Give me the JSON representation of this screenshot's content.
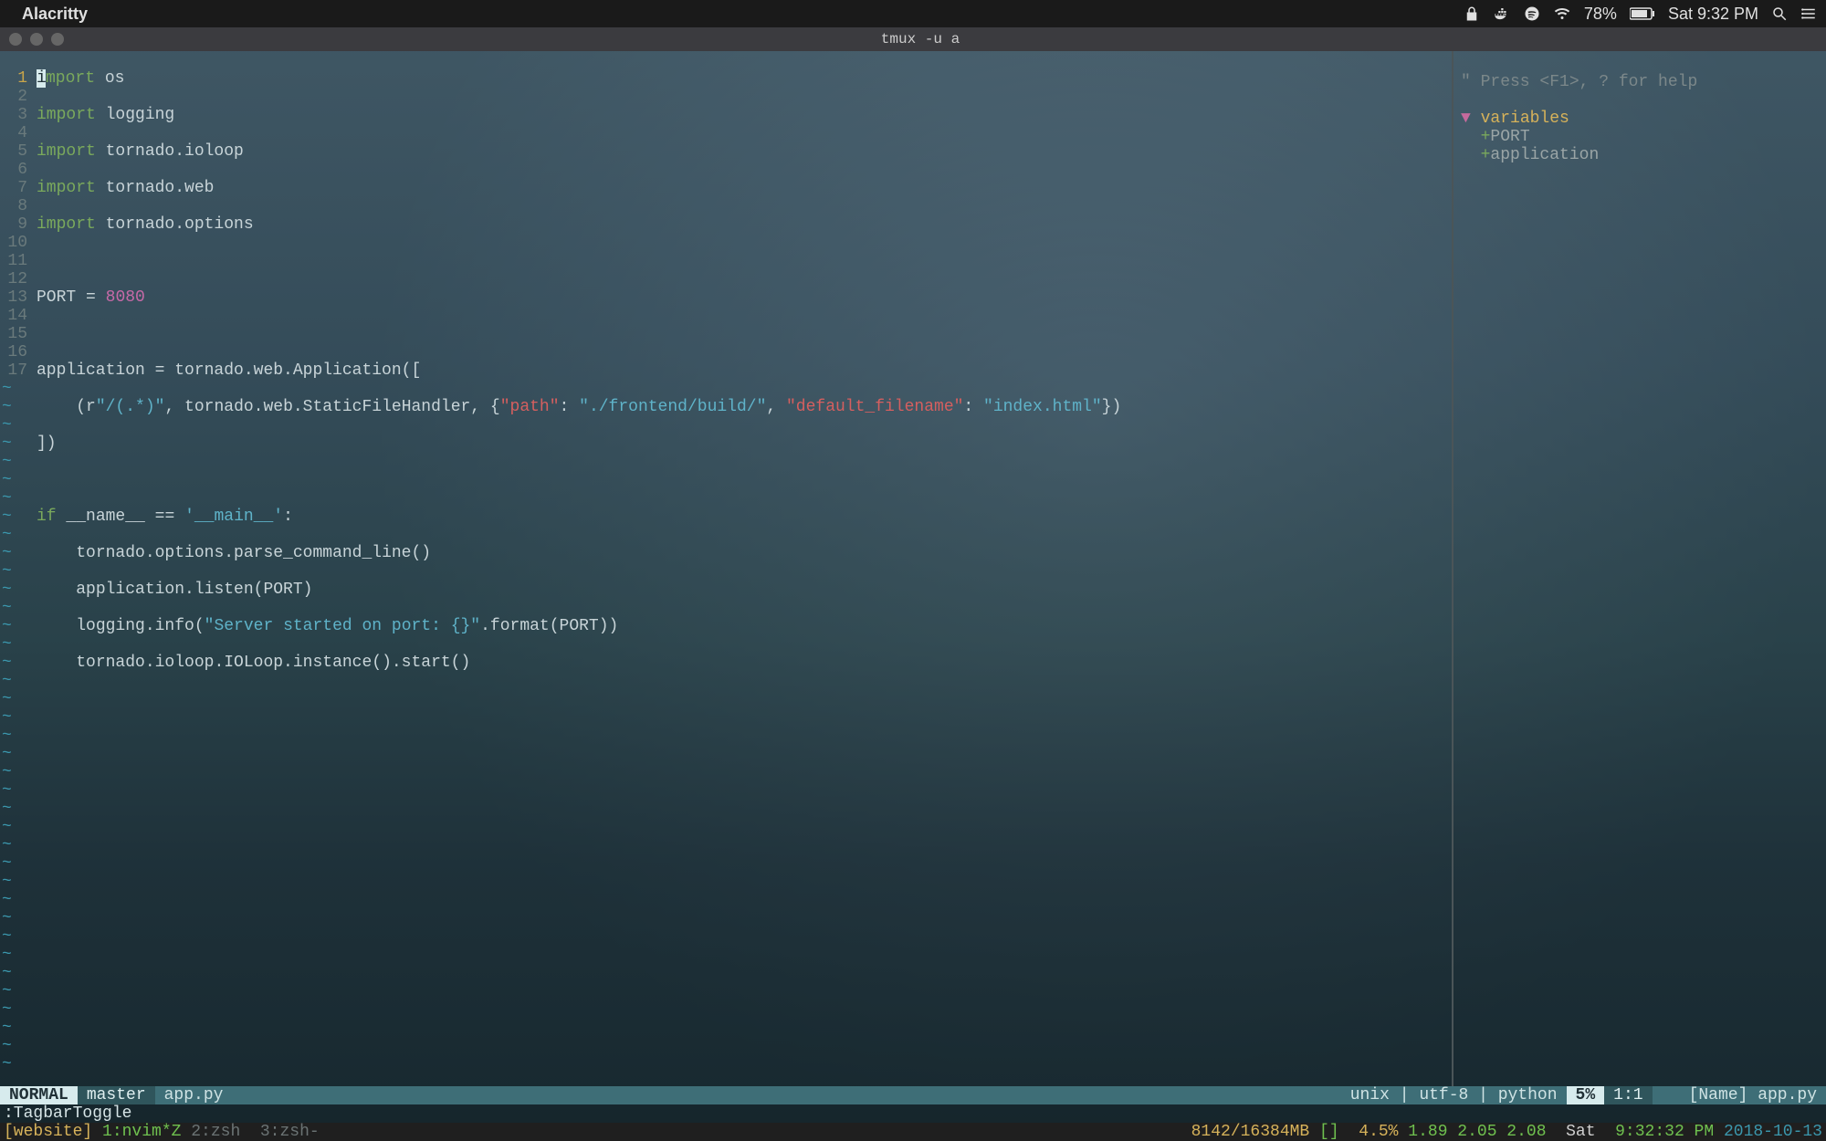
{
  "menubar": {
    "app_name": "Alacritty",
    "battery": "78%",
    "clock": "Sat 9:32 PM"
  },
  "window": {
    "title": "tmux -u a"
  },
  "editor": {
    "line_numbers": [
      "1",
      "2",
      "3",
      "4",
      "5",
      "6",
      "7",
      "8",
      "9",
      "10",
      "11",
      "12",
      "13",
      "14",
      "15",
      "16",
      "17"
    ],
    "current_line": 1,
    "code": {
      "l1": {
        "pre": "",
        "kw": "import",
        "rest": " os"
      },
      "l2": {
        "kw": "import",
        "rest": " logging"
      },
      "l3": {
        "kw": "import",
        "rest": " tornado.ioloop"
      },
      "l4": {
        "kw": "import",
        "rest": " tornado.web"
      },
      "l5": {
        "kw": "import",
        "rest": " tornado.options"
      },
      "l6": {
        "text": ""
      },
      "l7": {
        "a": "PORT ",
        "op": "=",
        "b": " ",
        "num": "8080"
      },
      "l8": {
        "text": ""
      },
      "l9": {
        "text": "application = tornado.web.Application(["
      },
      "l10": {
        "indent": "    ",
        "a": "(r",
        "s1": "\"/(.*)\"",
        "b": ", tornado.web.StaticFileHandler, {",
        "k1": "\"path\"",
        "c": ": ",
        "s2": "\"./frontend/build/\"",
        "d": ", ",
        "k2": "\"default_filename\"",
        "e": ": ",
        "s3": "\"index.html\"",
        "f": "})"
      },
      "l11": {
        "text": "])"
      },
      "l12": {
        "text": ""
      },
      "l13": {
        "kw": "if",
        "a": " __name__ ",
        "op": "==",
        "b": " ",
        "s": "'__main__'",
        "c": ":"
      },
      "l14": {
        "indent": "    ",
        "text": "tornado.options.parse_command_line()"
      },
      "l15": {
        "indent": "    ",
        "text": "application.listen(PORT)"
      },
      "l16": {
        "indent": "    ",
        "a": "logging.info(",
        "s": "\"Server started on port: {}\"",
        "b": ".format(PORT))"
      },
      "l17": {
        "indent": "    ",
        "text": "tornado.ioloop.IOLoop.instance().start()"
      }
    }
  },
  "tagbar": {
    "hint": "\" Press <F1>, ? for help",
    "blank": "",
    "heading": "variables",
    "items": [
      "PORT",
      "application"
    ]
  },
  "vim_status": {
    "mode": " NORMAL ",
    "branch": " master ",
    "file": " app.py ",
    "encoding": "unix | utf-8 | python",
    "percent": " 5% ",
    "pos": " 1:1 ",
    "tag_name": "[Name]",
    "tag_file": "app.py"
  },
  "cmdline": ":TagbarToggle",
  "tmux": {
    "session": "[website] ",
    "window_current": "1:nvim*Z",
    "window_2": " 2:zsh ",
    "window_3": " 3:zsh-",
    "bracket_open": "]",
    "mem": "  4.5%",
    "load": " 1.89 2.05 2.08",
    "day": "  Sat",
    "time": "  9:32:32 PM ",
    "date": "2018-10-13",
    "mem_total": " 8142/16384MB ",
    "bracket_left": "["
  }
}
